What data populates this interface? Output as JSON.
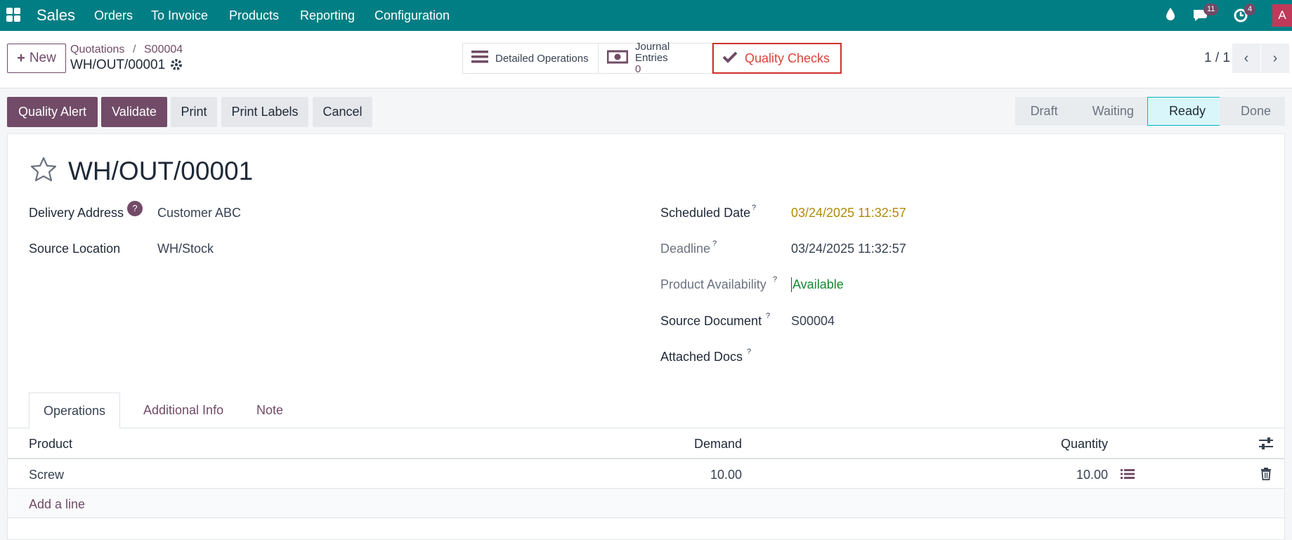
{
  "topbar": {
    "brand": "Sales",
    "menus": [
      "Orders",
      "To Invoice",
      "Products",
      "Reporting",
      "Configuration"
    ],
    "messages_count": "11",
    "activities_count": "4",
    "avatar_letter": "A",
    "colors": {
      "nav": "#017e84",
      "brand_accent": "#714b67"
    }
  },
  "control_panel": {
    "new_label": "New",
    "breadcrumb": [
      "Quotations",
      "S00004"
    ],
    "record_name": "WH/OUT/00001",
    "smart_buttons": {
      "detailed_operations": "Detailed Operations",
      "journal_entries": "Journal Entries",
      "journal_entries_count": "0",
      "quality_checks": "Quality Checks"
    },
    "pager": "1 / 1"
  },
  "statusbar": {
    "buttons": [
      "Quality Alert",
      "Validate",
      "Print",
      "Print Labels",
      "Cancel"
    ],
    "stages": [
      "Draft",
      "Waiting",
      "Ready",
      "Done"
    ],
    "active_stage": "Ready"
  },
  "form": {
    "title": "WH/OUT/00001",
    "delivery_address_label": "Delivery Address",
    "delivery_address_value": "Customer ABC",
    "source_location_label": "Source Location",
    "source_location_value": "WH/Stock",
    "scheduled_date_label": "Scheduled Date",
    "scheduled_date_value": "03/24/2025 11:32:57",
    "deadline_label": "Deadline",
    "deadline_value": "03/24/2025 11:32:57",
    "availability_label": "Product Availability",
    "availability_value": "Available",
    "source_document_label": "Source Document",
    "source_document_value": "S00004",
    "attached_docs_label": "Attached Docs",
    "help_mark": "?"
  },
  "tabs": [
    "Operations",
    "Additional Info",
    "Note"
  ],
  "table": {
    "headers": [
      "Product",
      "Demand",
      "Quantity"
    ],
    "rows": [
      {
        "product": "Screw",
        "demand": "10.00",
        "quantity": "10.00"
      }
    ],
    "add_line": "Add a line"
  }
}
